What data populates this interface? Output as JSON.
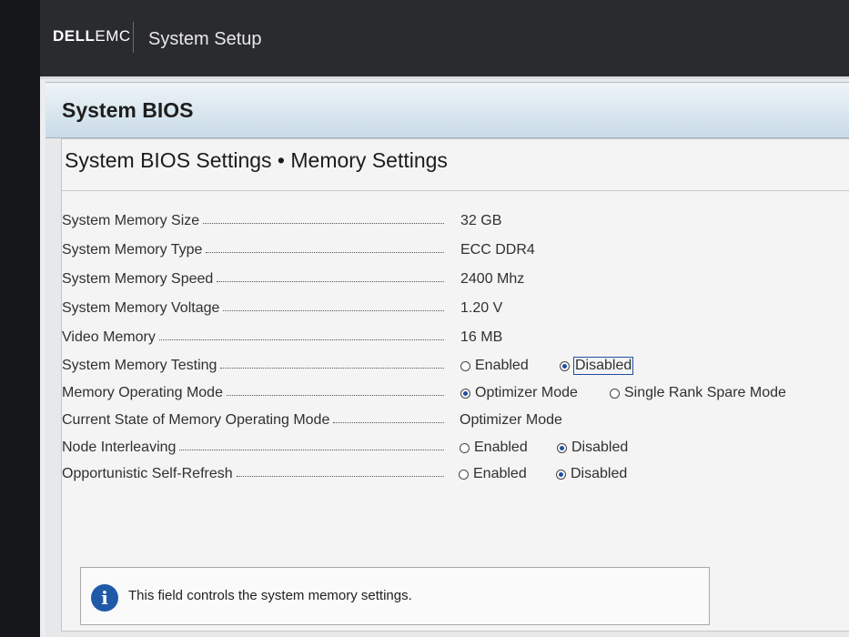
{
  "header": {
    "brand_dell": "DELL",
    "brand_emc": "EMC",
    "app_title": "System Setup"
  },
  "section": {
    "title": "System BIOS",
    "subtitle": "System BIOS Settings • Memory Settings"
  },
  "settings": [
    {
      "label": "System Memory Size",
      "value": "32 GB"
    },
    {
      "label": "System Memory Type",
      "value": "ECC DDR4"
    },
    {
      "label": "System Memory Speed",
      "value": "2400 Mhz"
    },
    {
      "label": "System Memory Voltage",
      "value": "1.20 V"
    },
    {
      "label": "Video Memory",
      "value": "16 MB"
    },
    {
      "label": "System Memory Testing",
      "options": [
        "Enabled",
        "Disabled"
      ],
      "selected": "Disabled"
    },
    {
      "label": "Memory Operating Mode",
      "options": [
        "Optimizer Mode",
        "Single Rank Spare Mode"
      ],
      "selected": "Optimizer Mode"
    },
    {
      "label": "Current State of Memory Operating Mode",
      "value": "Optimizer Mode"
    },
    {
      "label": "Node Interleaving",
      "options": [
        "Enabled",
        "Disabled"
      ],
      "selected": "Disabled"
    },
    {
      "label": "Opportunistic Self-Refresh",
      "options": [
        "Enabled",
        "Disabled"
      ],
      "selected": "Disabled"
    }
  ],
  "help": {
    "icon": "info-icon",
    "text": "This field controls the system memory settings."
  },
  "colors": {
    "accent": "#1f5aa8",
    "header_bg": "#2a2b2f"
  }
}
